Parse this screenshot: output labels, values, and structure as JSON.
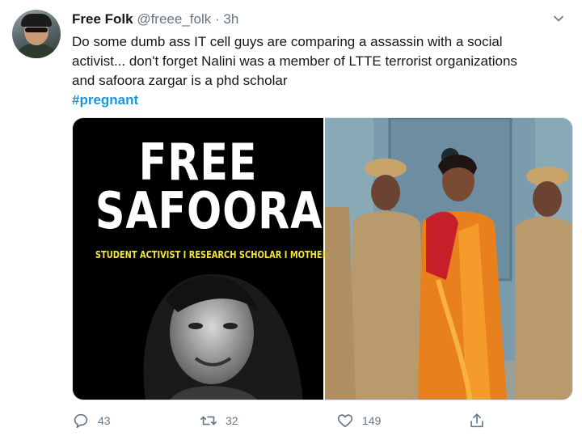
{
  "tweet": {
    "author_name": "Free Folk",
    "author_handle": "@freee_folk",
    "separator": "·",
    "time": "3h",
    "text_line1": "Do some dumb ass IT cell guys are comparing a assassin with a social",
    "text_line2": "activist... don't forget Nalini was a member of LTTE  terrorist organizations",
    "text_line3": "and safoora zargar is a phd scholar",
    "hashtag": "#pregnant"
  },
  "media": {
    "left_headline_1": "FREE",
    "left_headline_2": "SAFOORA!",
    "left_subtitle": "STUDENT ACTIVIST I RESEARCH SCHOLAR I MOTHER TO BE"
  },
  "actions": {
    "reply_count": "43",
    "retweet_count": "32",
    "like_count": "149"
  },
  "colors": {
    "link": "#1b95e0",
    "muted": "#657786",
    "subtitle_yellow": "#f4e33a"
  }
}
